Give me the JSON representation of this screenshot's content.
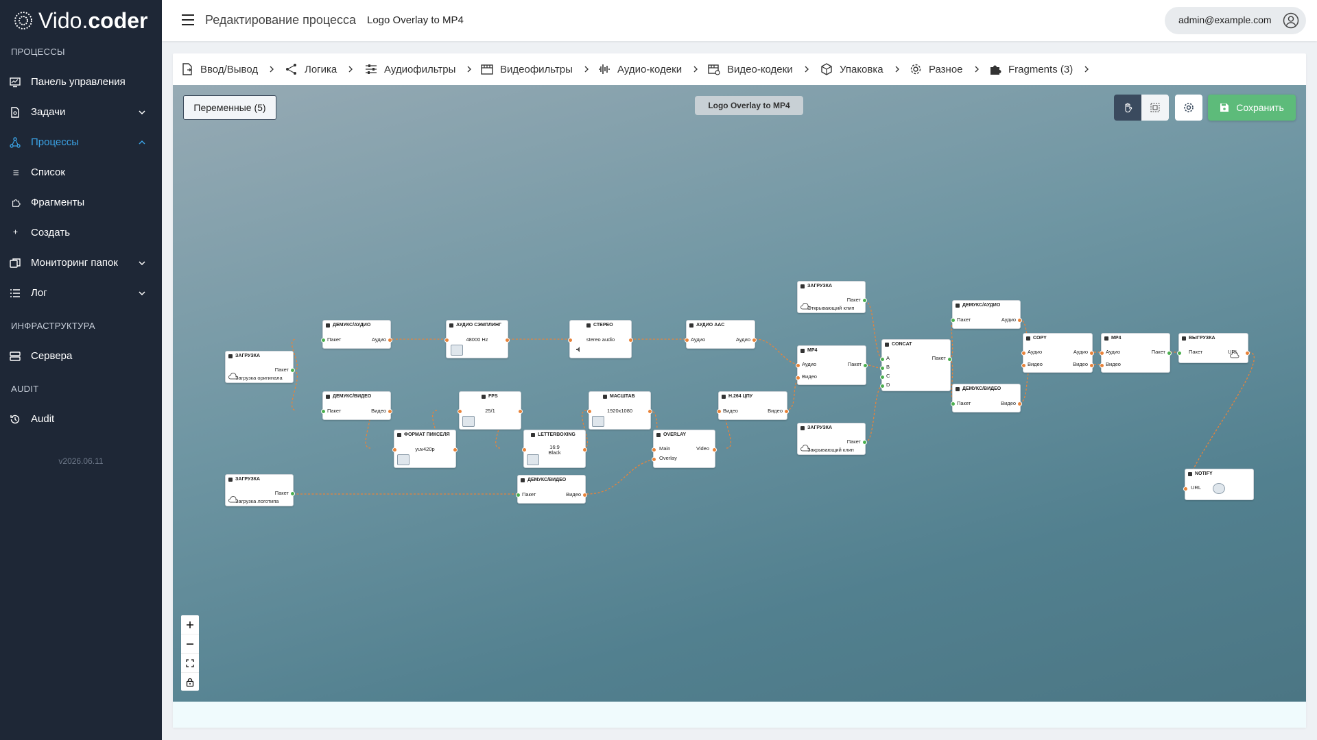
{
  "brand": {
    "name_light": "Vido.",
    "name_bold": "coder"
  },
  "sidebar": {
    "section_processes": "ПРОЦЕССЫ",
    "section_infra": "ИНФРАСТРУКТУРА",
    "section_audit": "AUDIT",
    "items": {
      "dashboard": "Панель управления",
      "tasks": "Задачи",
      "processes": "Процессы",
      "list": "Список",
      "fragments": "Фрагменты",
      "create": "Создать",
      "folder_monitoring": "Мониторинг папок",
      "log": "Лог",
      "servers": "Сервера",
      "audit": "Audit"
    },
    "version": "v2026.06.11"
  },
  "header": {
    "title": "Редактирование процесса",
    "process_name": "Logo Overlay to MP4",
    "user_email": "admin@example.com"
  },
  "breadcrumbs": [
    "Ввод/Вывод",
    "Логика",
    "Аудиофильтры",
    "Видеофильтры",
    "Аудио-кодеки",
    "Видео-кодеки",
    "Упаковка",
    "Разное",
    "Fragments (3)"
  ],
  "canvas": {
    "variables_button": "Переменные (5)",
    "flow_title": "Logo Overlay to MP4",
    "save_button": "Сохранить"
  },
  "nodes": {
    "load1": {
      "title": "ЗАГРУЗКА",
      "out": "Пакет",
      "caption": "Загрузка оригинала"
    },
    "load2": {
      "title": "ЗАГРУЗКА",
      "out": "Пакет",
      "caption": "Загрузка логотипа"
    },
    "load3": {
      "title": "ЗАГРУЗКА",
      "out": "Пакет",
      "caption": "Открывающий клип"
    },
    "load4": {
      "title": "ЗАГРУЗКА",
      "out": "Пакет",
      "caption": "Закрывающий клип"
    },
    "demux_a1": {
      "title": "ДЕМУКС/АУДИО",
      "in": "Пакет",
      "out": "Аудио"
    },
    "demux_v1": {
      "title": "ДЕМУКС/ВИДЕО",
      "in": "Пакет",
      "out": "Видео"
    },
    "demux_v2": {
      "title": "ДЕМУКС/ВИДЕО",
      "in": "Пакет",
      "out": "Видео"
    },
    "resample": {
      "title": "АУДИО СЭМПЛИНГ",
      "value": "48000 Hz"
    },
    "stereo": {
      "title": "СТЕРЕО",
      "value": "stereo audio"
    },
    "aac": {
      "title": "АУДИО AAC",
      "in": "Аудио",
      "out": "Аудио"
    },
    "fps": {
      "title": "FPS",
      "value": "25/1"
    },
    "pixfmt": {
      "title": "ФОРМАТ ПИКСЕЛЯ",
      "value": "yuv420p"
    },
    "letterbox": {
      "title": "LETTERBOXING",
      "value1": "16:9",
      "value2": "Black"
    },
    "scale": {
      "title": "МАСШТАБ",
      "value": "1920x1080"
    },
    "overlay": {
      "title": "OVERLAY",
      "in1": "Main",
      "in2": "Overlay",
      "out": "Video"
    },
    "h264": {
      "title": "H.264 ЦПУ",
      "in": "Видео",
      "out": "Видео"
    },
    "mp4a": {
      "title": "MP4",
      "in1": "Аудио",
      "in2": "Видео",
      "out": "Пакет"
    },
    "concat": {
      "title": "CONCAT",
      "in1": "A",
      "in2": "B",
      "in3": "C",
      "in4": "D",
      "out": "Пакет"
    },
    "demux_a3": {
      "title": "ДЕМУКС/АУДИО",
      "in": "Пакет",
      "out": "Аудио"
    },
    "demux_v3": {
      "title": "ДЕМУКС/ВИДЕО",
      "in": "Пакет",
      "out": "Видео"
    },
    "copy": {
      "title": "COPY",
      "in1": "Аудио",
      "in2": "Видео",
      "out1": "Аудио",
      "out2": "Видео"
    },
    "mp4b": {
      "title": "MP4",
      "in1": "Аудио",
      "in2": "Видео",
      "out": "Пакет"
    },
    "upload": {
      "title": "ВЫГРУЗКА",
      "in": "Пакет",
      "out": "URL"
    },
    "notify": {
      "title": "NOTIFY",
      "in": "URL"
    }
  },
  "colors": {
    "sidebar_bg": "#1e2736",
    "accent": "#3ba3e6",
    "save": "#5dbb7a",
    "edge": "#e8833a",
    "port_ok": "#4caf50"
  }
}
